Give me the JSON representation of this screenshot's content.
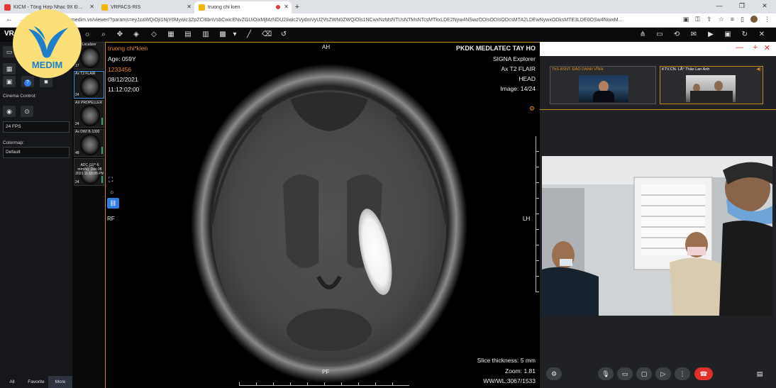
{
  "browser": {
    "tabs": [
      {
        "label": "KICM - Tổng Hợp Nhạc 9X Đời Đ",
        "icon_color": "#e53935"
      },
      {
        "label": "VRPACS-RIS",
        "icon_color": "#f6b400"
      },
      {
        "label": "truong chi kien",
        "icon_color": "#f6b400"
      }
    ],
    "new_tab": "+",
    "address": "medim.vn/viewer/?params=eyJzaWQiOjI1NjY0Mywic3ZpZCI6bnVsbCwicENvZGUiOixMjMzNDU2Iiwic2VydmVyU2VsZWN0ZWQiOls1NCwxNzMsNTUsNTMsNTcsMTkxLDE2Nyw4NSwzODIsODIsODcsMTA2LDEwNywxODksMTE3LDE0OSw4NiwxM..."
  },
  "logo": {
    "text": "MEDIM"
  },
  "app": {
    "brand": "VR"
  },
  "left_panel": {
    "cinema_label": "Cinema Control:",
    "fps_value": "24 FPS",
    "colormap_label": "Colormap:",
    "colormap_value": "Default",
    "bottom_tabs": [
      "All",
      "Favorite",
      "More"
    ]
  },
  "series": [
    {
      "title": "ane Localizer",
      "count": "17"
    },
    {
      "title": "Ax T2 FLAIR",
      "count": "24"
    },
    {
      "title": "AX PROPELLER",
      "count": "24"
    },
    {
      "title": "Ax DWI B-1000",
      "count": "48"
    },
    {
      "title": "ADC (10^-6 mm²/s): Dec 08 2021 11:15:05 PM",
      "count": "24"
    }
  ],
  "viewer": {
    "patient_name": "truong chi*kien",
    "age": "Age: 059Y",
    "patient_id": "1233456",
    "date": "08/12/2021",
    "time": "11:12:02:00",
    "institution": "PKDK MEDLATEC TAY HO",
    "scanner": "SIGNA Explorer",
    "sequence": "Ax T2 FLAIR",
    "body_part": "HEAD",
    "image_index": "Image: 14/24",
    "orient_top": "AH",
    "orient_bottom": "PF",
    "orient_left": "RF",
    "orient_right": "LH",
    "slice_thickness": "Slice thickness: 5 mm",
    "zoom": "Zoom: 1.81",
    "window": "WW/WL:3067/1533"
  },
  "call": {
    "participants": [
      {
        "name": "ThS.BSNT. ĐÀO DANH VĨNH",
        "color": "#e58a22"
      },
      {
        "name": "KTV.CN. LÃ° Thảo Lan Anh",
        "color": "#ffffff"
      }
    ],
    "accent": "#c08a1c"
  }
}
